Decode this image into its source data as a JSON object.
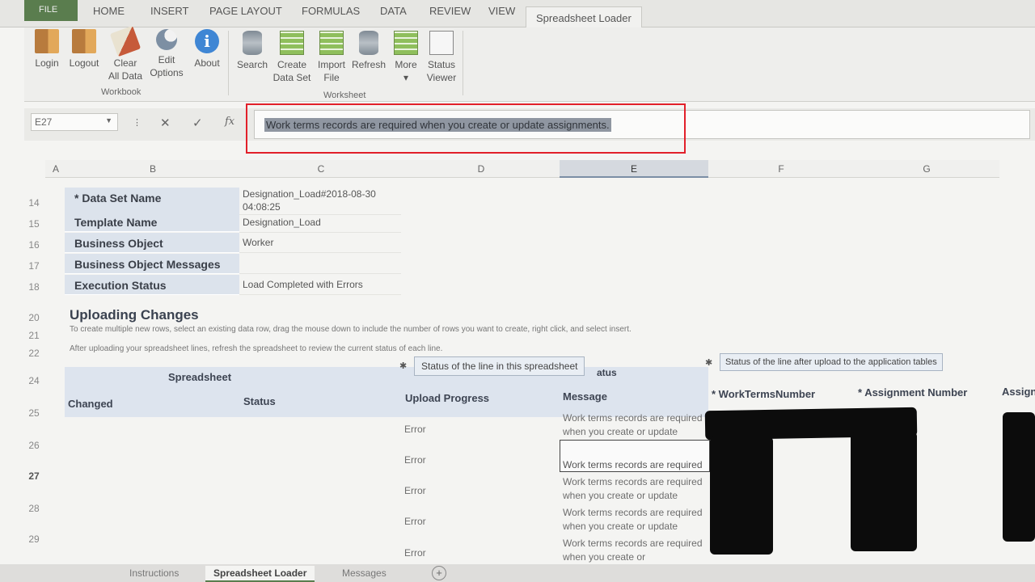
{
  "ribbon_tabs": [
    "FILE",
    "HOME",
    "INSERT",
    "PAGE LAYOUT",
    "FORMULAS",
    "DATA",
    "REVIEW",
    "VIEW",
    "Spreadsheet Loader"
  ],
  "workbook_group": {
    "label": "Workbook",
    "buttons": [
      {
        "line1": "Login",
        "line2": "",
        "icon": "login-door-icon"
      },
      {
        "line1": "Logout",
        "line2": "",
        "icon": "logout-door-icon"
      },
      {
        "line1": "Clear",
        "line2": "All Data",
        "icon": "eraser-icon"
      },
      {
        "line1": "Edit",
        "line2": "Options",
        "icon": "wrench-icon"
      },
      {
        "line1": "About",
        "line2": "",
        "icon": "info-icon"
      }
    ]
  },
  "worksheet_group": {
    "label": "Worksheet",
    "buttons": [
      {
        "line1": "Search",
        "line2": "",
        "icon": "database-icon"
      },
      {
        "line1": "Create",
        "line2": "Data Set",
        "icon": "sheet-gear-icon"
      },
      {
        "line1": "Import",
        "line2": "File",
        "icon": "sheet-gear-icon"
      },
      {
        "line1": "Refresh",
        "line2": "",
        "icon": "database-icon"
      },
      {
        "line1": "More",
        "line2": "▾",
        "icon": "sheet-icon"
      },
      {
        "line1": "Status",
        "line2": "Viewer",
        "icon": "status-viewer-icon"
      }
    ]
  },
  "formula_bar": {
    "name_box": "E27",
    "cancel": "✕",
    "enter": "✓",
    "fx": "fx",
    "formula_text": "Work terms records are required when you create or update assignments."
  },
  "columns": [
    "A",
    "B",
    "C",
    "D",
    "E",
    "F",
    "G"
  ],
  "row_numbers": [
    "14",
    "15",
    "16",
    "17",
    "18",
    "20",
    "21",
    "22",
    "24",
    "25",
    "26",
    "27",
    "28",
    "29"
  ],
  "dataset": [
    {
      "label": "* Data Set Name",
      "value": "Designation_Load#2018-08-30",
      "value2": "04:08:25"
    },
    {
      "label": "Template Name",
      "value": "Designation_Load"
    },
    {
      "label": "Business Object",
      "value": "Worker"
    },
    {
      "label": "Business Object Messages",
      "value": ""
    },
    {
      "label": "Execution Status",
      "value": "Load Completed with Errors"
    }
  ],
  "uploading": {
    "title": "Uploading Changes",
    "help1": "To create multiple new rows, select an existing data row, drag the mouse down to include the number of rows you want to create, right click, and select insert.",
    "help2": "After uploading your spreadsheet lines, refresh the spreadsheet to review the current status of each line."
  },
  "table": {
    "group_spreadsheet": "Spreadsheet",
    "group_status_partial": "atus",
    "col_changed": "Changed",
    "col_status": "Status",
    "col_upload_progress": "Upload Progress",
    "col_message": "Message",
    "col_work_terms": "* WorkTermsNumber",
    "col_assignment": "* Assignment Number",
    "col_assign_partial": "Assign",
    "tooltip_spreadsheet": "Status of the line in this spreadsheet",
    "tooltip_application": "Status of the line after upload to the application tables",
    "rows": [
      {
        "progress": "Error",
        "message": "Work terms records are required when you create or update assignments."
      },
      {
        "progress": "Error",
        "message": "Work terms records are required"
      },
      {
        "progress": "Error",
        "message": "Work terms records are required when you create or update assignments."
      },
      {
        "progress": "Error",
        "message": "Work terms records are required when you create or update assignments."
      },
      {
        "progress": "Error",
        "message": "Work terms records are required when you create or"
      }
    ]
  },
  "sheet_tabs": [
    "Instructions",
    "Spreadsheet Loader",
    "Messages"
  ]
}
